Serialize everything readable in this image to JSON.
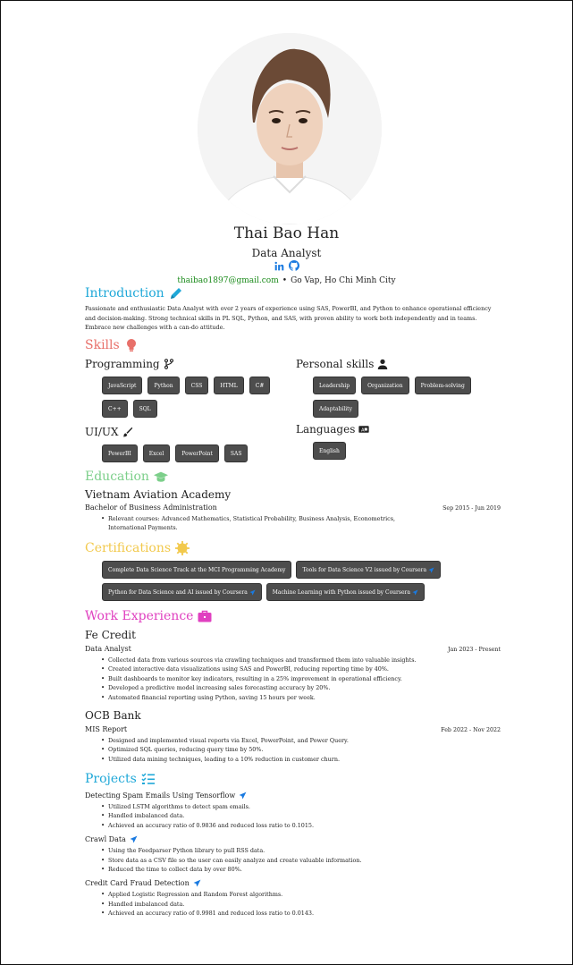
{
  "header": {
    "name": "Thai Bao Han",
    "role": "Data Analyst",
    "email": "thaibao1897@gmail.com",
    "separator": "•",
    "location": "Go Vap, Ho Chi Minh City",
    "social_icons": [
      "linkedin-icon",
      "github-icon"
    ]
  },
  "intro": {
    "title": "Introduction",
    "text": "Passionate and enthusiastic Data Analyst with over 2 years of experience using SAS, PowerBI, and Python to enhance operational efficiency and decision-making. Strong technical skills in PL SQL, Python, and SAS, with proven ability to work both independently and in teams. Embrace new challenges with a can-do attitude."
  },
  "skills": {
    "title": "Skills",
    "programming": {
      "title": "Programming",
      "items": [
        "JavaScript",
        "Python",
        "CSS",
        "HTML",
        "C#",
        "C++",
        "SQL"
      ]
    },
    "personal": {
      "title": "Personal skills",
      "items": [
        "Leadership",
        "Organization",
        "Problem-solving",
        "Adaptability"
      ]
    },
    "uiux": {
      "title": "UI/UX",
      "items": [
        "PowerBI",
        "Excel",
        "PowerPoint",
        "SAS"
      ]
    },
    "languages": {
      "title": "Languages",
      "items": [
        "English"
      ]
    }
  },
  "education": {
    "title": "Education",
    "school": "Vietnam Aviation Academy",
    "degree": "Bachelor of Business Administration",
    "date": "Sep 2015 - Jun 2019",
    "bullets": [
      "Relevant courses: Advanced Mathematics, Statistical Probability, Business Analysis, Econometrics, International Payments."
    ]
  },
  "certifications": {
    "title": "Certifications",
    "items": [
      "Complete Data Science Track at the MCI Programming Academy",
      "Tools for Data Science V2 issued by Coursera",
      "Python for Data Science and AI issued by Coursera",
      "Machine Learning with Python issued by Coursera"
    ]
  },
  "work": {
    "title": "Work Experience",
    "jobs": [
      {
        "company": "Fe Credit",
        "position": "Data Analyst",
        "date": "Jan 2023 - Present",
        "bullets": [
          "Collected data from various sources via crawling techniques and transformed them into valuable insights.",
          "Created interactive data visualizations using SAS and PowerBI, reducing reporting time by 40%.",
          "Built dashboards to monitor key indicators, resulting in a 25% improvement in operational efficiency.",
          "Developed a predictive model increasing sales forecasting accuracy by 20%.",
          "Automated financial reporting using Python, saving 15 hours per week."
        ]
      },
      {
        "company": "OCB Bank",
        "position": "MIS Report",
        "date": "Feb 2022 - Nov 2022",
        "bullets": [
          "Designed and implemented visual reports via Excel, PowerPoint, and Power Query.",
          "Optimized SQL queries, reducing query time by 50%.",
          "Utilized data mining techniques, leading to a 10% reduction in customer churn."
        ]
      }
    ]
  },
  "projects": {
    "title": "Projects",
    "items": [
      {
        "name": "Detecting Spam Emails Using Tensorflow",
        "bullets": [
          "Utilized LSTM algorithms to detect spam emails.",
          "Handled imbalanced data.",
          "Achieved an accuracy ratio of 0.9836 and reduced loss ratio to 0.1015."
        ]
      },
      {
        "name": "Crawl Data",
        "bullets": [
          "Using the Feedparser Python library to pull RSS data.",
          "Store data as a CSV file so the user can easily analyze and create valuable information.",
          "Reduced the time to collect data by over 80%."
        ]
      },
      {
        "name": "Credit Card Fraud Detection",
        "bullets": [
          "Applied Logistic Regression and Random Forest algorithms.",
          "Handled imbalanced data.",
          "Achieved an accuracy ratio of 0.9981 and reduced loss ratio to 0.0143."
        ]
      }
    ]
  },
  "colors": {
    "introduction": "#1fa8d8",
    "skills": "#e8706a",
    "education": "#7ccf8a",
    "certifications": "#f2c94c",
    "work": "#e040c0",
    "projects": "#1fa8d8",
    "tag_bg": "#4d4d4d",
    "email": "#1a8a1a",
    "link": "#1a7ae0"
  }
}
